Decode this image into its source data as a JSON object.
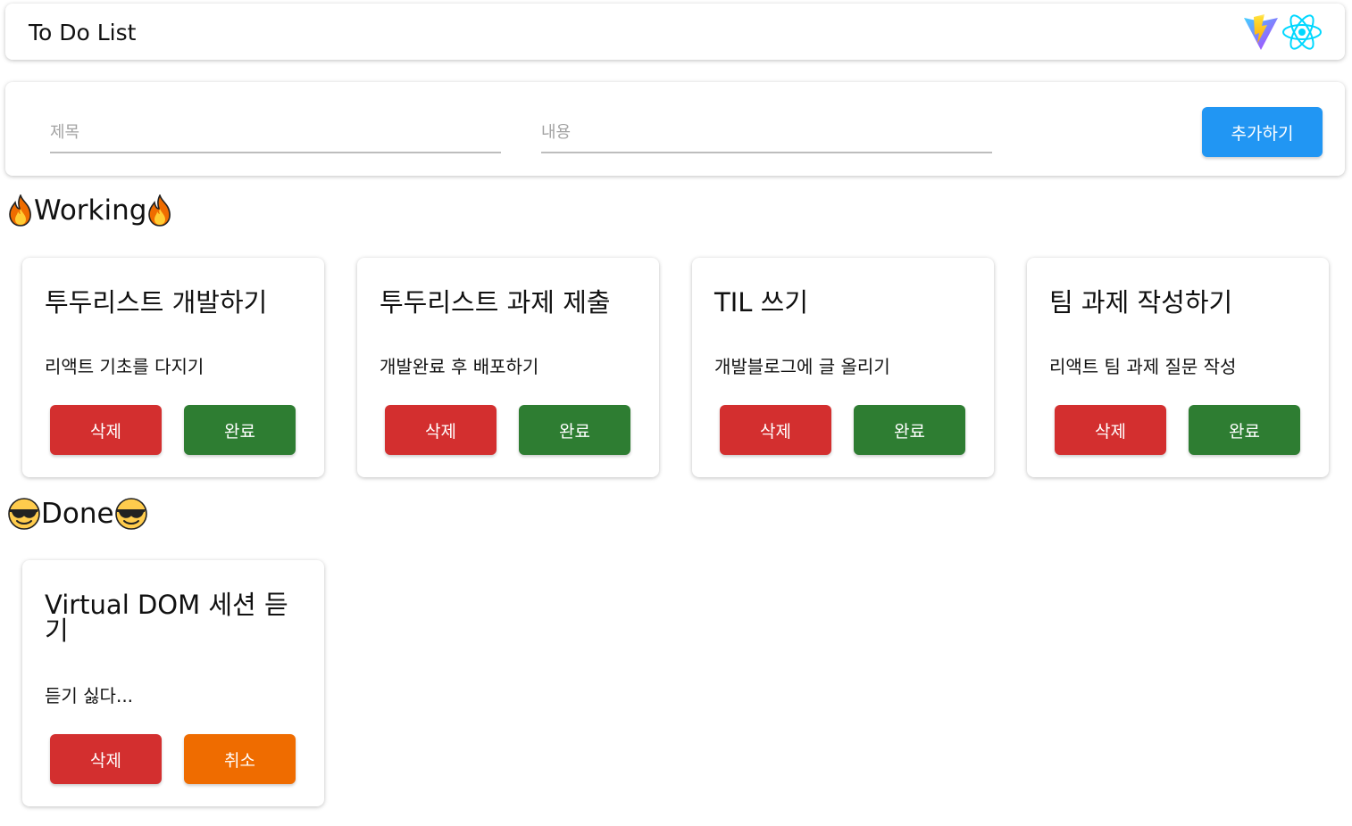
{
  "header": {
    "title": "To Do List",
    "logos": [
      "vite-logo",
      "react-logo"
    ]
  },
  "form": {
    "title_placeholder": "제목",
    "content_placeholder": "내용",
    "title_value": "",
    "content_value": "",
    "add_label": "추가하기"
  },
  "sections": {
    "working": {
      "label": "Working",
      "icon": "fire-emoji"
    },
    "done": {
      "label": "Done",
      "icon": "sunglasses-emoji"
    }
  },
  "working": [
    {
      "title": "투두리스트 개발하기",
      "body": "리액트 기초를 다지기",
      "delete_label": "삭제",
      "action_label": "완료"
    },
    {
      "title": "투두리스트 과제 제출",
      "body": "개발완료 후 배포하기",
      "delete_label": "삭제",
      "action_label": "완료"
    },
    {
      "title": "TIL 쓰기",
      "body": "개발블로그에 글 올리기",
      "delete_label": "삭제",
      "action_label": "완료"
    },
    {
      "title": "팀 과제 작성하기",
      "body": "리액트 팀 과제 질문 작성",
      "delete_label": "삭제",
      "action_label": "완료"
    }
  ],
  "done": [
    {
      "title": "Virtual DOM 세션 듣기",
      "body": "듣기 싫다...",
      "delete_label": "삭제",
      "action_label": "취소"
    }
  ],
  "colors": {
    "add": "#2196f3",
    "delete": "#d32f2f",
    "complete": "#2e7d32",
    "cancel": "#ef6c00"
  }
}
